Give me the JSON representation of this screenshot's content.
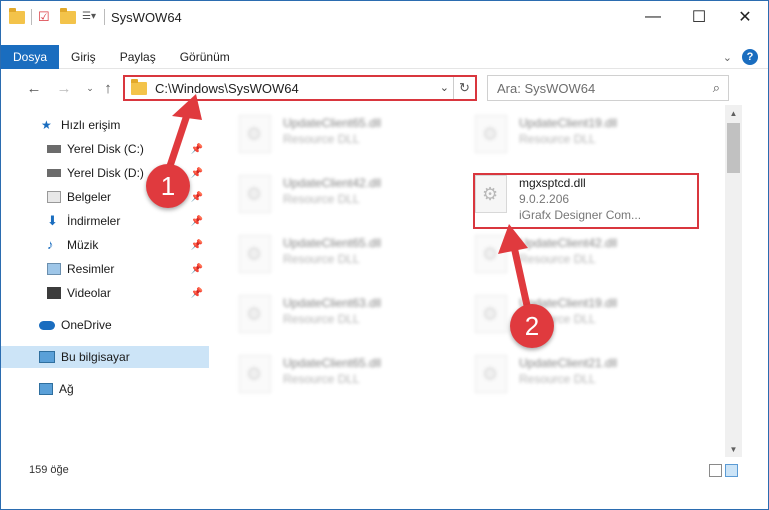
{
  "window": {
    "title": "SysWOW64"
  },
  "ribbon": {
    "tabs": [
      "Dosya",
      "Giriş",
      "Paylaş",
      "Görünüm"
    ],
    "active_tab": "Dosya"
  },
  "address": {
    "path": "C:\\Windows\\SysWOW64"
  },
  "search": {
    "placeholder": "Ara: SysWOW64"
  },
  "sidebar": {
    "items": [
      {
        "label": "Hızlı erişim"
      },
      {
        "label": "Yerel Disk (C:)"
      },
      {
        "label": "Yerel Disk (D:)"
      },
      {
        "label": "Belgeler"
      },
      {
        "label": "İndirmeler"
      },
      {
        "label": "Müzik"
      },
      {
        "label": "Resimler"
      },
      {
        "label": "Videolar"
      },
      {
        "label": "OneDrive"
      },
      {
        "label": "Bu bilgisayar"
      },
      {
        "label": "Ağ"
      }
    ]
  },
  "files": {
    "col1": [
      {
        "name": "UpdateClient65.dll",
        "type": "Resource DLL"
      },
      {
        "name": "UpdateClient42.dll",
        "type": "Resource DLL"
      },
      {
        "name": "UpdateClient65.dll",
        "type": "Resource DLL"
      },
      {
        "name": "UpdateClient63.dll",
        "type": "Resource DLL"
      },
      {
        "name": "UpdateClient65.dll",
        "type": "Resource DLL"
      }
    ],
    "col2": [
      {
        "name": "UpdateClient19.dll",
        "type": "Resource DLL"
      },
      {
        "name": "UpdateClient42.dll",
        "type": "Resource DLL"
      },
      {
        "name": "UpdateClient19.dll",
        "type": "Resource DLL"
      },
      {
        "name": "UpdateClient21.dll",
        "type": "Resource DLL"
      }
    ],
    "highlighted": {
      "name": "mgxsptcd.dll",
      "version": "9.0.2.206",
      "company": "iGrafx Designer Com..."
    }
  },
  "status": {
    "item_count": "159 öğe"
  },
  "callouts": [
    "1",
    "2"
  ],
  "colors": {
    "accent": "#1a6dbf",
    "annotation": "#e03a3e"
  }
}
